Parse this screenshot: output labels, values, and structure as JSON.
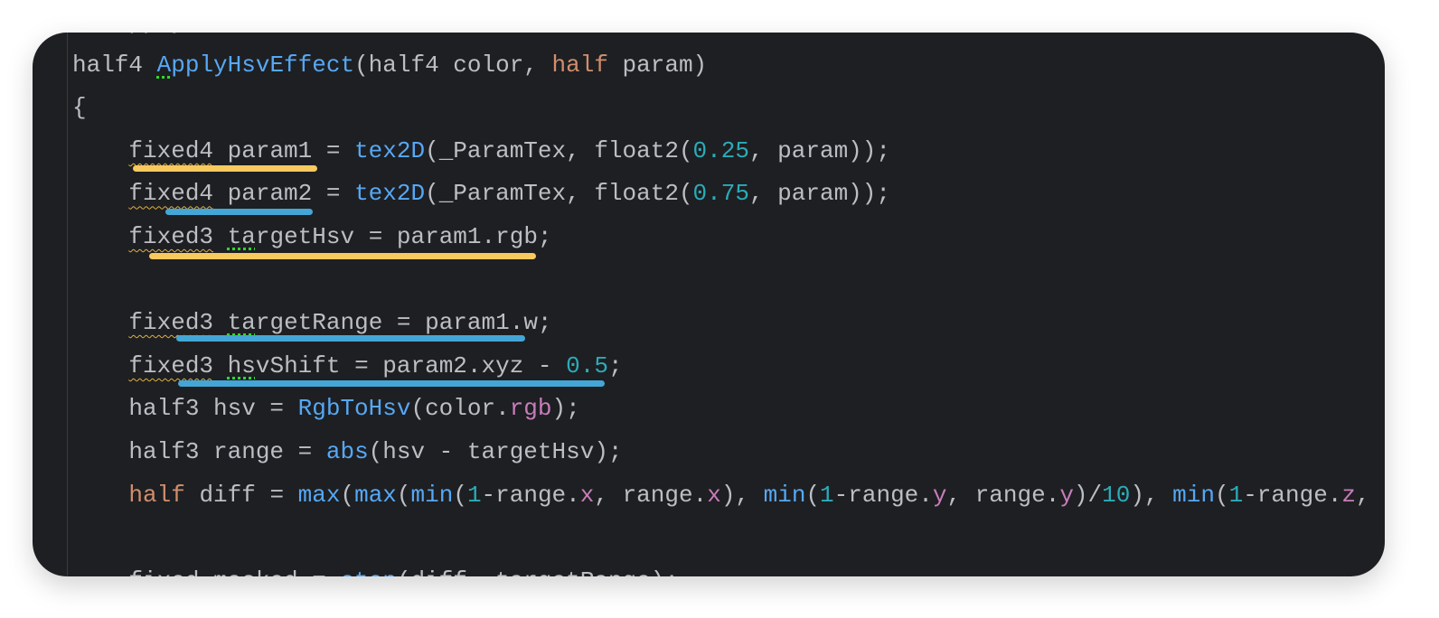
{
  "editor": {
    "colors": {
      "background": "#1e1f22",
      "default": "#bcbec4",
      "function": "#56a8f5",
      "keyword": "#cf8e6d",
      "number": "#2aacb8",
      "swizzle": "#c77dbb",
      "highlight_yellow": "#f7c95f",
      "highlight_blue": "#44a6d6"
    },
    "lines": [
      [
        [
          "// Apply",
          ""
        ]
      ],
      [
        [
          "half4 ",
          "def"
        ],
        [
          "A",
          "fn hint"
        ],
        [
          "pplyHsvEffect",
          "fn"
        ],
        [
          "(half4 color, ",
          "def"
        ],
        [
          "half",
          "kw"
        ],
        [
          " param)",
          "def"
        ]
      ],
      [
        [
          "{",
          "def"
        ]
      ],
      [
        [
          "    ",
          "def"
        ],
        [
          "fixed4",
          "def warn"
        ],
        [
          " param1 = ",
          "def"
        ],
        [
          "tex2D",
          "fn"
        ],
        [
          "(_ParamTex, float2(",
          "def"
        ],
        [
          "0.25",
          "num"
        ],
        [
          ", param));",
          "def"
        ]
      ],
      [
        [
          "    ",
          "def"
        ],
        [
          "fixed4",
          "def warn"
        ],
        [
          " param2 = ",
          "def"
        ],
        [
          "tex2D",
          "fn"
        ],
        [
          "(_ParamTex, float2(",
          "def"
        ],
        [
          "0.75",
          "num"
        ],
        [
          ", param));",
          "def"
        ]
      ],
      [
        [
          "    ",
          "def"
        ],
        [
          "fixed3",
          "def warn"
        ],
        [
          " ",
          "def"
        ],
        [
          "ta",
          "def hint"
        ],
        [
          "rgetHsv = param1.rgb;",
          "def"
        ]
      ],
      [
        [
          "",
          "def"
        ]
      ],
      [
        [
          "    ",
          "def"
        ],
        [
          "fixed3",
          "def warn"
        ],
        [
          " ",
          "def"
        ],
        [
          "ta",
          "def hint"
        ],
        [
          "rgetRange = param1.w;",
          "def"
        ]
      ],
      [
        [
          "    ",
          "def"
        ],
        [
          "fixed3",
          "def warn"
        ],
        [
          " ",
          "def"
        ],
        [
          "hs",
          "def hint"
        ],
        [
          "vShift = param2.xyz - ",
          "def"
        ],
        [
          "0.5",
          "num"
        ],
        [
          ";",
          "def"
        ]
      ],
      [
        [
          "    half3 hsv = ",
          "def"
        ],
        [
          "RgbToHsv",
          "fn"
        ],
        [
          "(color.",
          "def"
        ],
        [
          "rgb",
          "sw"
        ],
        [
          ");",
          "def"
        ]
      ],
      [
        [
          "    half3 range = ",
          "def"
        ],
        [
          "abs",
          "fn"
        ],
        [
          "(hsv - targetHsv);",
          "def"
        ]
      ],
      [
        [
          "    ",
          "def"
        ],
        [
          "half",
          "kw"
        ],
        [
          " diff = ",
          "def"
        ],
        [
          "max",
          "fn"
        ],
        [
          "(",
          "def"
        ],
        [
          "max",
          "fn"
        ],
        [
          "(",
          "def"
        ],
        [
          "min",
          "fn"
        ],
        [
          "(",
          "def"
        ],
        [
          "1",
          "num"
        ],
        [
          "-range.",
          "def"
        ],
        [
          "x",
          "sw"
        ],
        [
          ", range.",
          "def"
        ],
        [
          "x",
          "sw"
        ],
        [
          "), ",
          "def"
        ],
        [
          "min",
          "fn"
        ],
        [
          "(",
          "def"
        ],
        [
          "1",
          "num"
        ],
        [
          "-range.",
          "def"
        ],
        [
          "y",
          "sw"
        ],
        [
          ", range.",
          "def"
        ],
        [
          "y",
          "sw"
        ],
        [
          ")/",
          "def"
        ],
        [
          "10",
          "num"
        ],
        [
          "), ",
          "def"
        ],
        [
          "min",
          "fn"
        ],
        [
          "(",
          "def"
        ],
        [
          "1",
          "num"
        ],
        [
          "-range.",
          "def"
        ],
        [
          "z",
          "sw"
        ],
        [
          ",",
          "def"
        ]
      ],
      [
        [
          "",
          "def"
        ]
      ],
      [
        [
          "    fixed masked = ",
          "def"
        ],
        [
          "step",
          "fn"
        ],
        [
          "(diff, targetRange);",
          "def"
        ]
      ]
    ]
  }
}
